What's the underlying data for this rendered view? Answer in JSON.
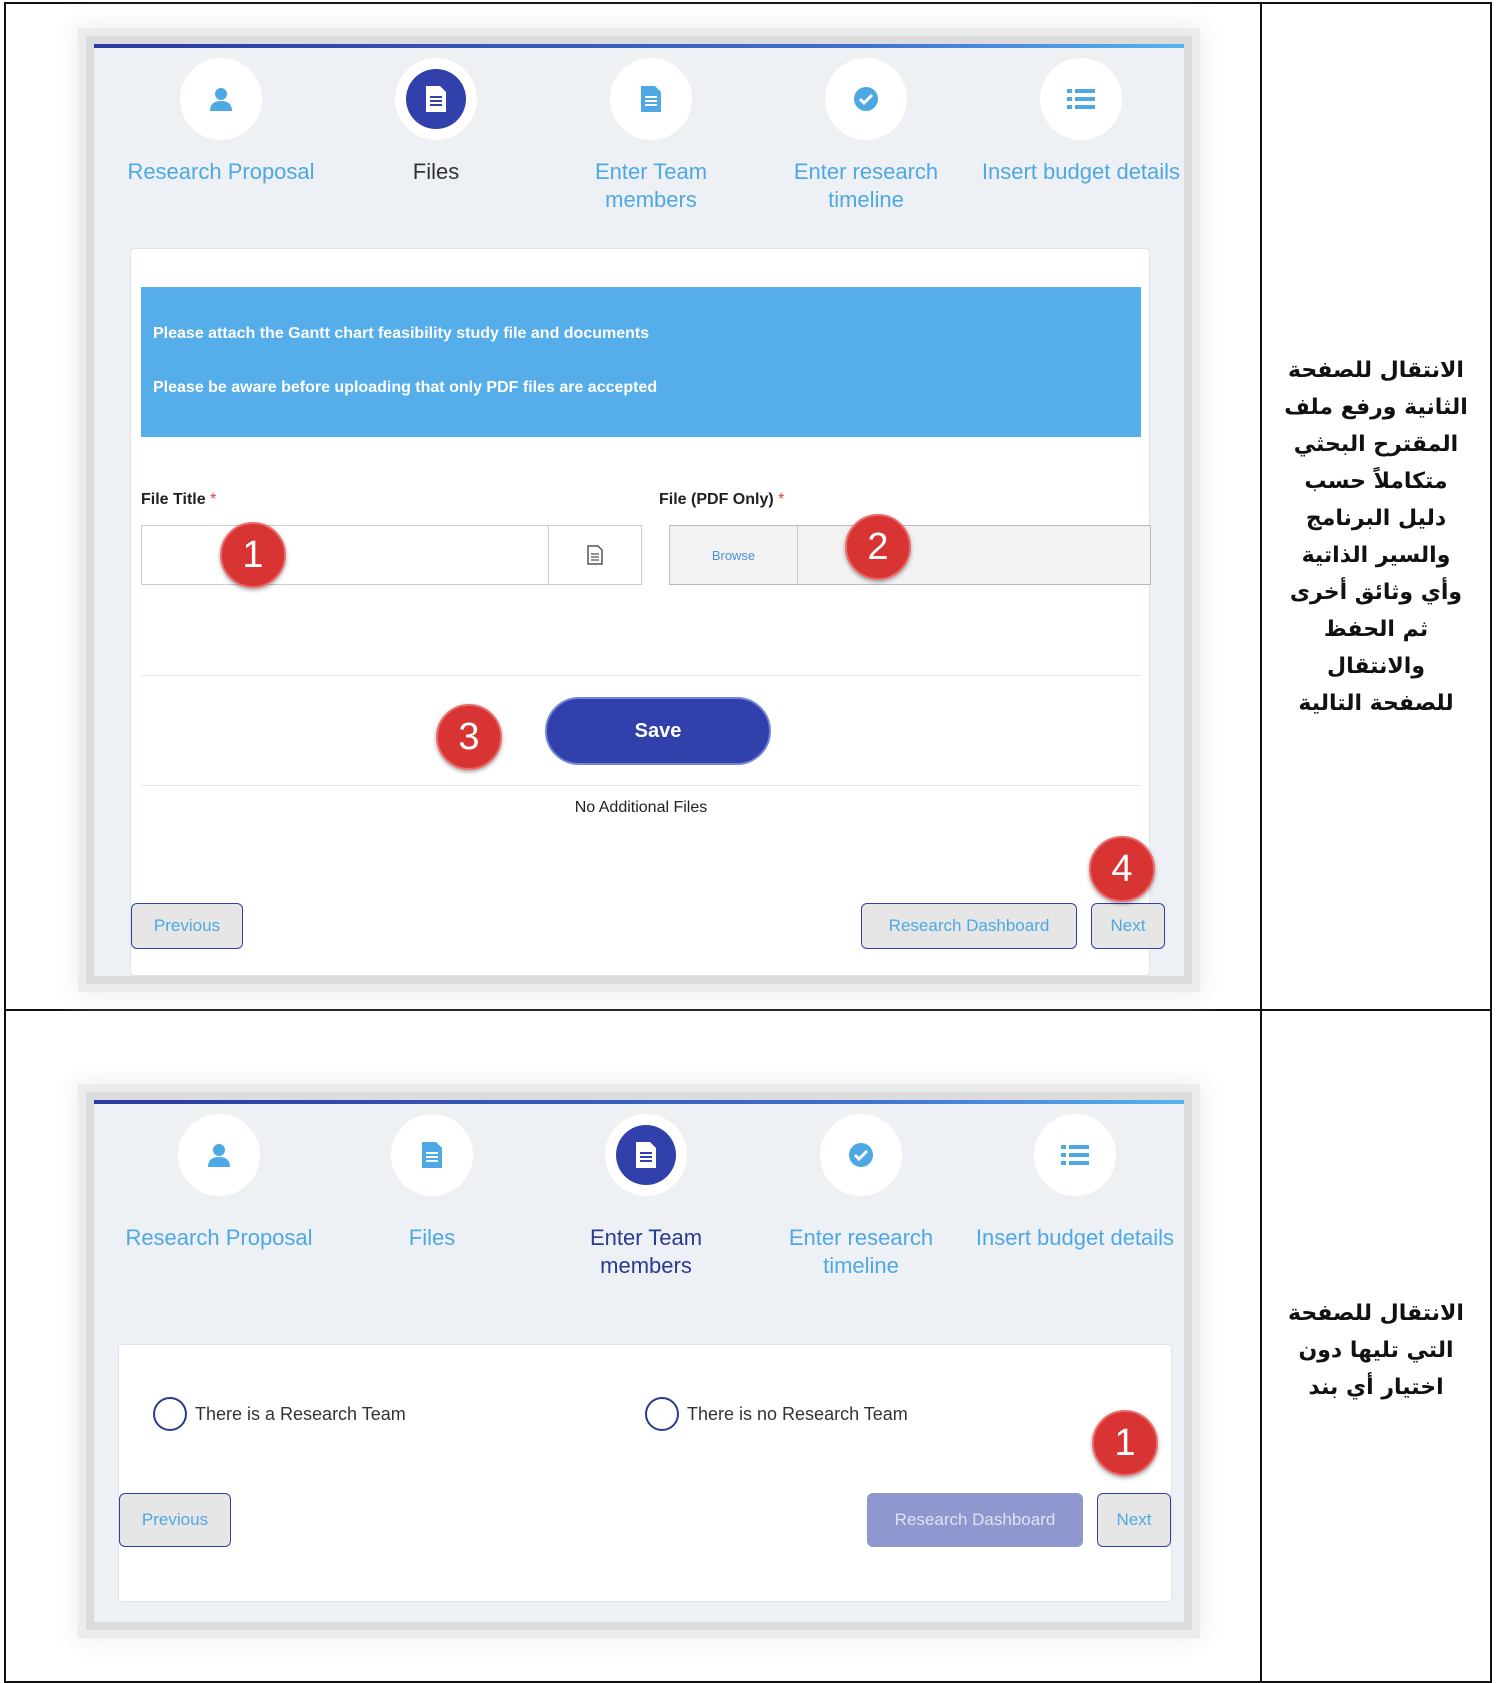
{
  "steps": [
    {
      "label": "Research Proposal",
      "icon": "user-icon"
    },
    {
      "label": "Files",
      "icon": "file-icon"
    },
    {
      "label": "Enter Team members",
      "icon": "file-icon"
    },
    {
      "label": "Enter research timeline",
      "icon": "check-circle-icon"
    },
    {
      "label": "Insert budget details",
      "icon": "list-icon"
    }
  ],
  "row1": {
    "instruction": [
      "الانتقال للصفحة",
      "الثانية ورفع ملف",
      "المقترح البحثي",
      "متكاملاً حسب",
      "دليل البرنامج",
      "والسير الذاتية",
      "وأي وثائق أخرى",
      "ثم الحفظ",
      "والانتقال",
      "للصفحة التالية"
    ],
    "info_line1": "Please attach the Gantt chart feasibility study file and documents",
    "info_line2": "Please be aware before uploading that only PDF files are accepted",
    "file_title_label": "File Title",
    "file_label": "File (PDF Only)",
    "required_mark": "*",
    "file_title_value": "",
    "browse_label": "Browse",
    "save_label": "Save",
    "no_files_text": "No Additional Files",
    "previous_label": "Previous",
    "dashboard_label": "Research Dashboard",
    "next_label": "Next",
    "badges": [
      "1",
      "2",
      "3",
      "4"
    ]
  },
  "row2": {
    "instruction": [
      "الانتقال للصفحة",
      "التي تليها دون",
      "اختيار أي بند"
    ],
    "option_team": "There is a Research Team",
    "option_no_team": "There is no Research Team",
    "previous_label": "Previous",
    "dashboard_label": "Research Dashboard",
    "next_label": "Next",
    "badge": "1"
  },
  "colors": {
    "primary": "#3240ab",
    "link": "#4ea8e3",
    "info": "#55aee9",
    "badge": "#d83434"
  }
}
